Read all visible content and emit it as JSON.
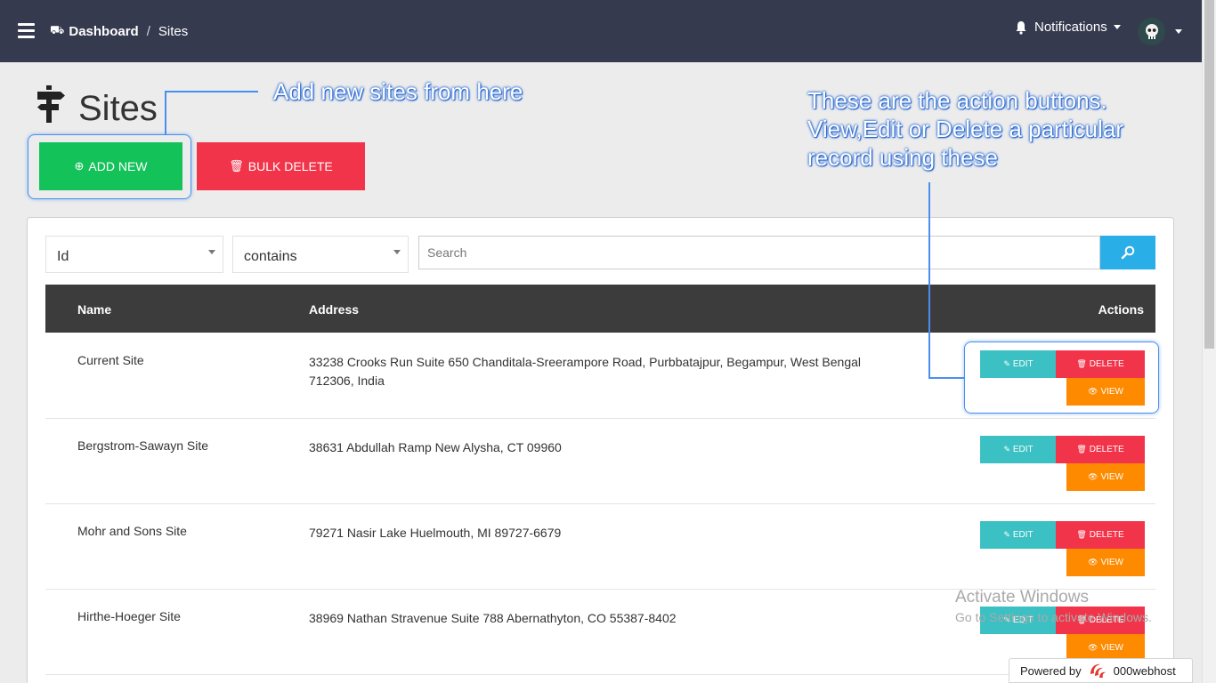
{
  "navbar": {
    "breadcrumb_home": "Dashboard",
    "breadcrumb_separator": "/",
    "breadcrumb_current": "Sites",
    "notifications_label": "Notifications"
  },
  "page": {
    "title": "Sites",
    "add_new_label": "ADD NEW",
    "bulk_delete_label": "BULK DELETE"
  },
  "annotations": {
    "add_new_hint": "Add new sites from here",
    "actions_hint_line1": "These are the action buttons.",
    "actions_hint_line2": "View,Edit or Delete a particular",
    "actions_hint_line3": "record using these"
  },
  "filters": {
    "field_value": "Id",
    "operator_value": "contains",
    "search_placeholder": "Search"
  },
  "table": {
    "headers": {
      "name": "Name",
      "address": "Address",
      "actions": "Actions"
    },
    "action_labels": {
      "edit": "EDIT",
      "delete": "DELETE",
      "view": "VIEW"
    },
    "rows": [
      {
        "name": "Current Site",
        "address": "33238 Crooks Run Suite 650 Chanditala-Sreerampore Road, Purbbatajpur, Begampur, West Bengal 712306, India"
      },
      {
        "name": "Bergstrom-Sawayn Site",
        "address": "38631 Abdullah Ramp New Alysha, CT 09960"
      },
      {
        "name": "Mohr and Sons Site",
        "address": "79271 Nasir Lake Huelmouth, MI 89727-6679"
      },
      {
        "name": "Hirthe-Hoeger Site",
        "address": "38969 Nathan Stravenue Suite 788 Abernathyton, CO 55387-8402"
      }
    ]
  },
  "watermark": {
    "line1": "Activate Windows",
    "line2": "Go to Settings to activate Windows."
  },
  "footer": {
    "powered_by": "Powered by",
    "host_name": "000webhost"
  },
  "colors": {
    "navbar": "#363a4f",
    "add_button": "#14c25a",
    "delete": "#f2344b",
    "edit": "#3bc0c3",
    "view": "#fe8a00",
    "search_button": "#2aaee8",
    "table_header": "#3c3c3c",
    "annotation": "#4a8ff0"
  },
  "icons": {
    "menu": "hamburger-icon",
    "brand": "car-icon",
    "notifications": "bell-icon",
    "avatar": "skull-avatar",
    "page": "signpost-icon",
    "add": "plus-circle-icon",
    "bulk_delete": "trash-icon",
    "search": "search-icon",
    "edit": "edit-icon",
    "delete": "trash-icon",
    "view": "eye-icon"
  }
}
